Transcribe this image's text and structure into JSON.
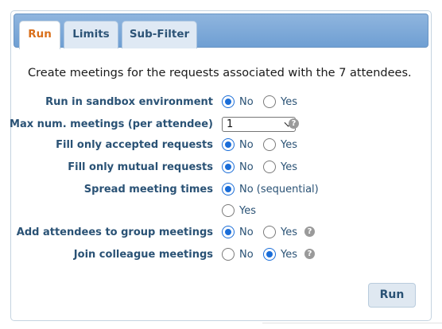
{
  "tabs": [
    {
      "label": "Run",
      "active": true
    },
    {
      "label": "Limits",
      "active": false
    },
    {
      "label": "Sub-Filter",
      "active": false
    }
  ],
  "intro": "Create meetings for the requests associated with the 7 attendees.",
  "fields": {
    "sandbox": {
      "label": "Run in sandbox environment",
      "opt1": "No",
      "opt2": "Yes",
      "selected": "No"
    },
    "max_meetings": {
      "label": "Max num. meetings (per attendee)",
      "value": "1"
    },
    "accepted": {
      "label": "Fill only accepted requests",
      "opt1": "No",
      "opt2": "Yes",
      "selected": "No"
    },
    "mutual": {
      "label": "Fill only mutual requests",
      "opt1": "No",
      "opt2": "Yes",
      "selected": "No"
    },
    "spread": {
      "label": "Spread meeting times",
      "opt1": "No (sequential)",
      "opt2": "Yes",
      "selected": "No (sequential)"
    },
    "group": {
      "label": "Add attendees to group meetings",
      "opt1": "No",
      "opt2": "Yes",
      "selected": "No"
    },
    "colleague": {
      "label": "Join colleague meetings",
      "opt1": "No",
      "opt2": "Yes",
      "selected": "Yes"
    }
  },
  "help_glyph": "?",
  "run_button": "Run",
  "colors": {
    "accent": "#1a6dd8",
    "active_tab_text": "#d96f1b",
    "label_text": "#2a5275",
    "tabbar": "#7aa7d8"
  }
}
